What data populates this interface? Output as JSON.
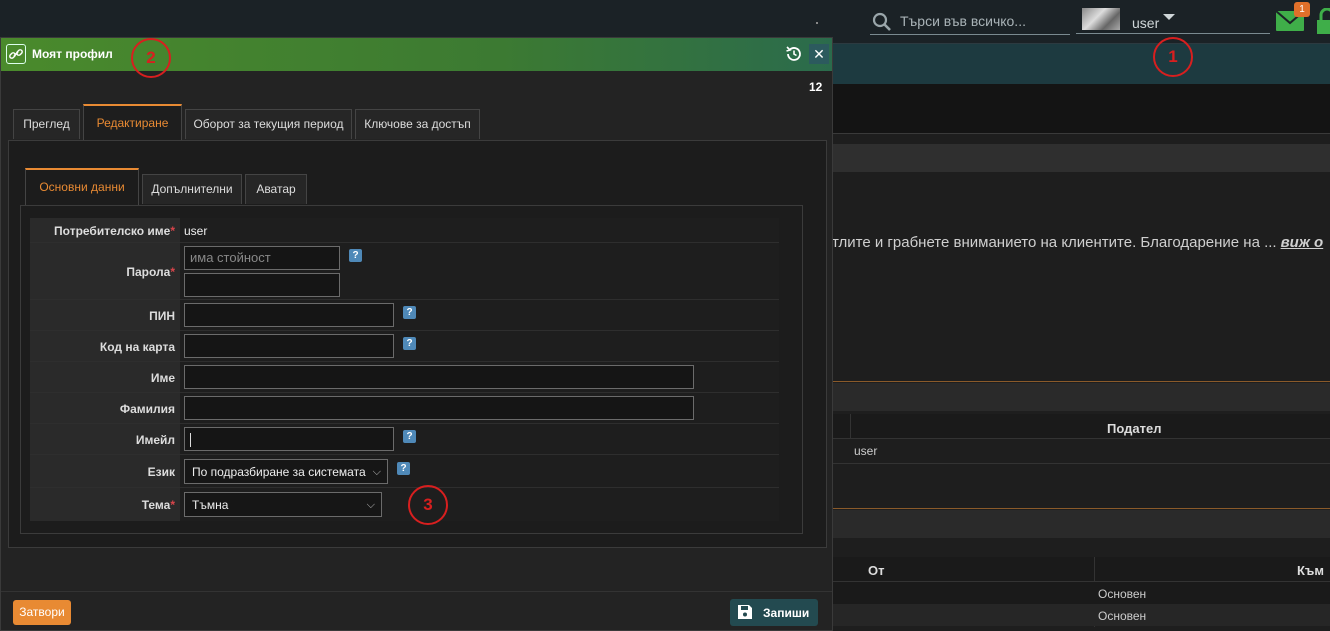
{
  "topbar": {
    "search_placeholder": "Търси във всичко...",
    "username": "user",
    "mail_count": "1",
    "accent_green": "#3fae49"
  },
  "background": {
    "marquee_text": "тлите и грабнете вниманието на клиентите. Благодарение на ...",
    "marquee_more": "виж о",
    "table1": {
      "header_sender": "Подател",
      "cell_sender": "user"
    },
    "table2": {
      "header_from": "От",
      "header_to": "Към",
      "rows": [
        "Основен",
        "Основен"
      ]
    }
  },
  "annotations": [
    "1",
    "2",
    "3"
  ],
  "modal": {
    "title": "Моят профил",
    "counter": "12",
    "tabs": [
      "Преглед",
      "Редактиране",
      "Оборот за текущия период",
      "Ключове за достъп"
    ],
    "active_tab": "Редактиране",
    "subtabs": [
      "Основни данни",
      "Допълнителни",
      "Аватар"
    ],
    "active_subtab": "Основни данни",
    "fields": {
      "username": {
        "label": "Потребителско име",
        "value": "user"
      },
      "password": {
        "label": "Парола",
        "placeholder": "има стойност",
        "value": ""
      },
      "pin": {
        "label": "ПИН",
        "value": ""
      },
      "card_code": {
        "label": "Код на карта",
        "value": ""
      },
      "first_name": {
        "label": "Име",
        "value": ""
      },
      "last_name": {
        "label": "Фамилия",
        "value": ""
      },
      "email": {
        "label": "Имейл",
        "value": ""
      },
      "language": {
        "label": "Език",
        "value": "По подразбиране за системата"
      },
      "theme": {
        "label": "Тема",
        "value": "Тъмна"
      }
    },
    "required_mark": "*",
    "help_glyph": "?",
    "buttons": {
      "close": "Затвори",
      "save": "Запиши"
    },
    "colors": {
      "accent_orange": "#e88a33",
      "header_green": "#4a8a2c",
      "annotation_red": "#d81f1f"
    }
  }
}
